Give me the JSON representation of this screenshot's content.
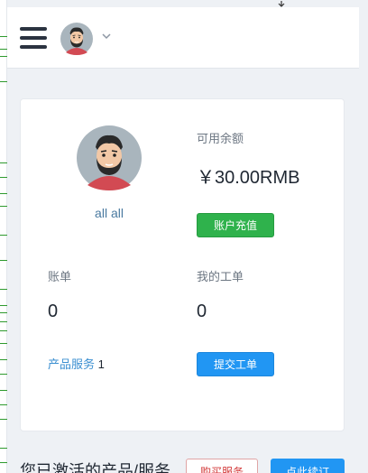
{
  "header": {
    "menu_icon": "hamburger-menu-icon",
    "avatar_icon": "user-avatar-icon",
    "dropdown_icon": "chevron-down-icon"
  },
  "profile": {
    "username": "all all"
  },
  "balance": {
    "label": "可用余额",
    "amount": "￥30.00RMB",
    "recharge_button": "账户充值"
  },
  "bills": {
    "label": "账单",
    "value": "0"
  },
  "tickets": {
    "label": "我的工单",
    "value": "0",
    "submit_button": "提交工单"
  },
  "products": {
    "link_label": "产品服务",
    "count": "1"
  },
  "section": {
    "title": "您已激活的产品/服务",
    "buy_button": "购买服务",
    "renew_button": "点此续订"
  },
  "colors": {
    "primary": "#2196f3",
    "success": "#2fb24c",
    "danger": "#d33a3a",
    "link": "#3b8fd1",
    "background": "#eef1f5"
  }
}
